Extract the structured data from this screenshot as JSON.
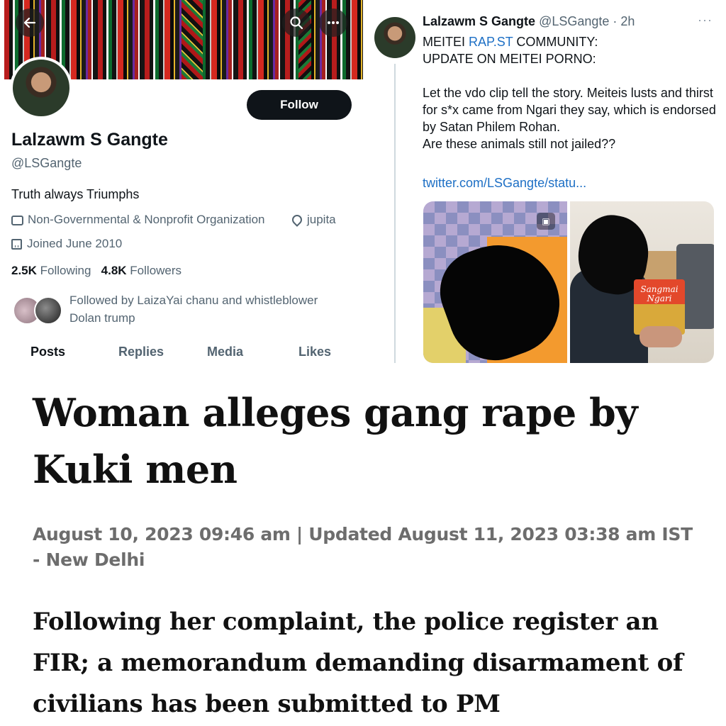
{
  "profile": {
    "display_name": "Lalzawm S Gangte",
    "handle": "@LSGangte",
    "bio": "Truth always Triumphs",
    "category": "Non-Governmental & Nonprofit Organization",
    "location": "jupita",
    "joined": "Joined June 2010",
    "following_count": "2.5K",
    "following_label": "Following",
    "followers_count": "4.8K",
    "followers_label": "Followers",
    "followed_by": "Followed by LaizaYai chanu and whistleblower Dolan trump",
    "follow_button": "Follow",
    "tabs": [
      "Posts",
      "Replies",
      "Media",
      "Likes"
    ],
    "icons": {
      "back": "back-arrow-icon",
      "search": "search-icon",
      "more": "more-icon"
    }
  },
  "tweet": {
    "author_name": "Lalzawm S Gangte",
    "author_handle_time": "@LSGangte · 2h",
    "more": "···",
    "line1_prefix": "MEITEI ",
    "line1_link": "RAP.ST",
    "line1_suffix": " COMMUNITY:",
    "line2": "UPDATE ON MEITEI PORNO:",
    "body": "Let the vdo clip tell the story. Meiteis lusts and thirst for s*x came from Ngari they say, which is endorsed by Satan Philem Rohan.",
    "question": "Are these animals still not jailed??",
    "link": "twitter.com/LSGangte/statu...",
    "pack_text_1": "Sangmai",
    "pack_text_2": "Ngari"
  },
  "article": {
    "headline": "Woman alleges gang rape by Kuki men",
    "dateline": "August 10, 2023 09:46 am | Updated August 11, 2023 03:38 am IST - New Delhi",
    "subhead": "Following her complaint, the police register an FIR; a memorandum demanding disarmament of civilians has been submitted to PM"
  },
  "colors": {
    "link": "#1d6fc5",
    "muted": "#536471",
    "button_bg": "#0f1419"
  }
}
